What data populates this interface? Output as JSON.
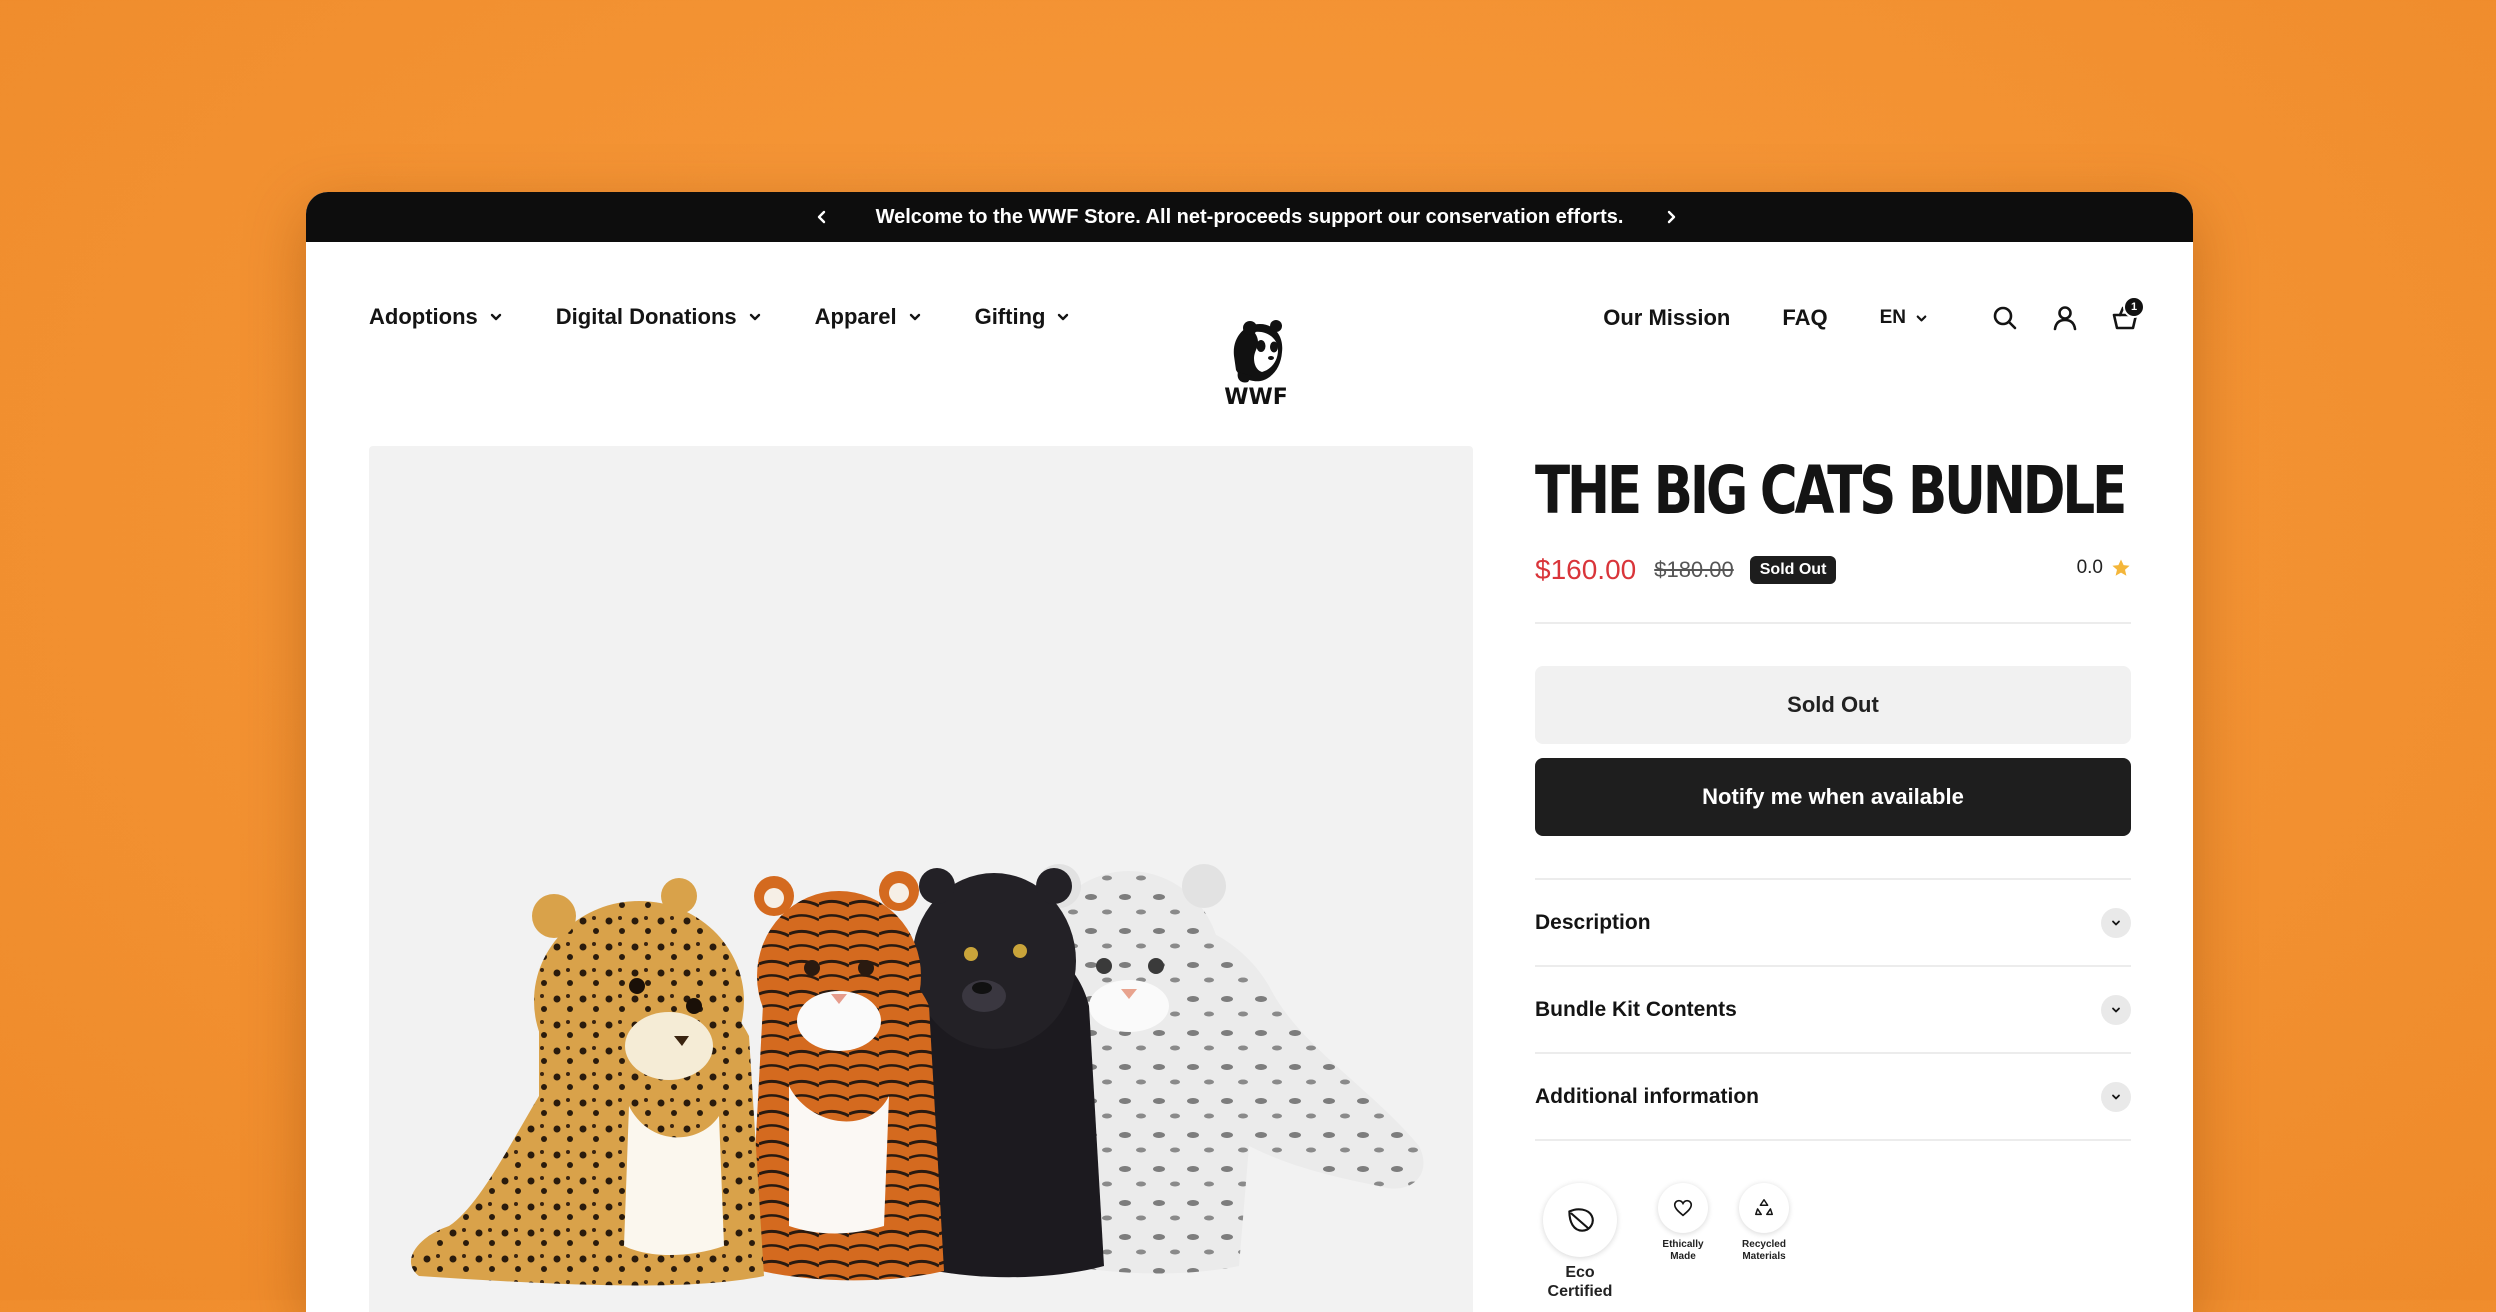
{
  "announcement": {
    "text": "Welcome to the WWF Store. All net-proceeds support our conservation efforts."
  },
  "nav": {
    "items": [
      {
        "label": "Adoptions"
      },
      {
        "label": "Digital Donations"
      },
      {
        "label": "Apparel"
      },
      {
        "label": "Gifting"
      }
    ],
    "logo_text": "WWF",
    "right_links": [
      {
        "label": "Our Mission"
      },
      {
        "label": "FAQ"
      }
    ],
    "language": "EN",
    "cart_count": "1"
  },
  "product": {
    "title": "THE BIG CATS BUNDLE",
    "price": "$160.00",
    "compare_price": "$180.00",
    "badge": "Sold Out",
    "rating": "0.0",
    "sold_out_button": "Sold Out",
    "notify_button": "Notify me when available",
    "accordions": [
      {
        "label": "Description"
      },
      {
        "label": "Bundle Kit Contents"
      },
      {
        "label": "Additional information"
      }
    ],
    "features": [
      {
        "label": "Eco Certified",
        "icon": "leaf-icon"
      },
      {
        "label": "Ethically Made",
        "icon": "heart-icon"
      },
      {
        "label": "Recycled Materials",
        "icon": "recycle-icon"
      }
    ]
  },
  "colors": {
    "background": "#f39232",
    "sale_price": "#d9353a",
    "button_dark": "#1e1e1e",
    "star": "#f4b63a"
  }
}
